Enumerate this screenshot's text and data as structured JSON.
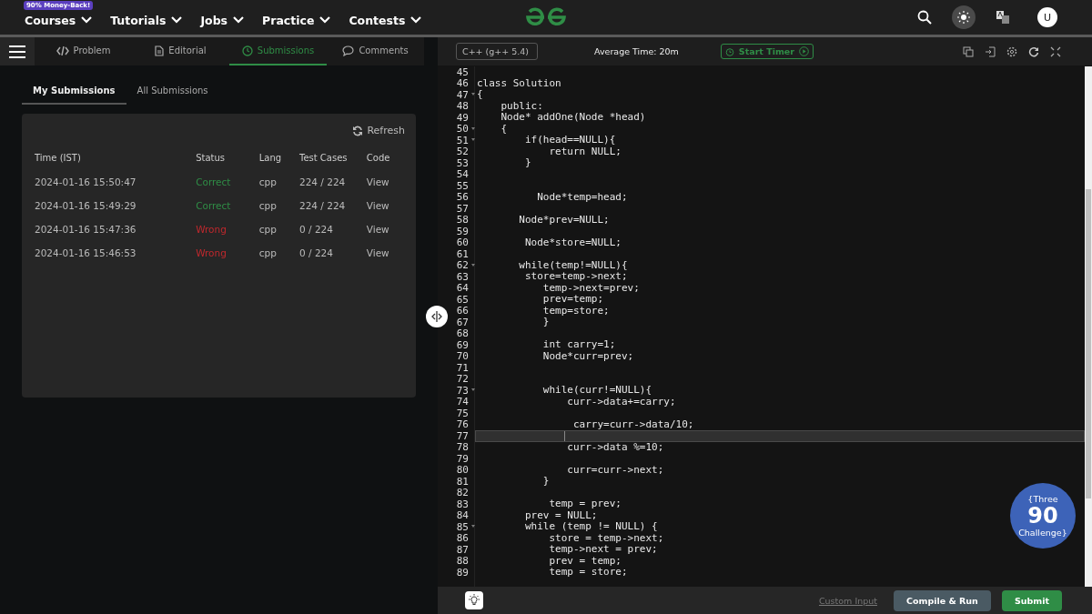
{
  "nav": {
    "badge": "90% Money-Back!",
    "menus": [
      "Courses",
      "Tutorials",
      "Jobs",
      "Practice",
      "Contests"
    ],
    "avatar": "U"
  },
  "tabs": [
    {
      "label": "Problem",
      "selected": false
    },
    {
      "label": "Editorial",
      "selected": false
    },
    {
      "label": "Submissions",
      "selected": true
    },
    {
      "label": "Comments",
      "selected": false
    }
  ],
  "subtabs": [
    {
      "label": "My Submissions",
      "selected": true
    },
    {
      "label": "All Submissions",
      "selected": false
    }
  ],
  "refresh": "Refresh",
  "table": {
    "columns": [
      "Time (IST)",
      "Status",
      "Lang",
      "Test Cases",
      "Code"
    ],
    "rows": [
      {
        "time": "2024-01-16 15:50:47",
        "status": "Correct",
        "kind": "correct",
        "lang": "cpp",
        "tests": "224 / 224",
        "code": "View"
      },
      {
        "time": "2024-01-16 15:49:29",
        "status": "Correct",
        "kind": "correct",
        "lang": "cpp",
        "tests": "224 / 224",
        "code": "View"
      },
      {
        "time": "2024-01-16 15:47:36",
        "status": "Wrong",
        "kind": "wrong",
        "lang": "cpp",
        "tests": "0 / 224",
        "code": "View"
      },
      {
        "time": "2024-01-16 15:46:53",
        "status": "Wrong",
        "kind": "wrong",
        "lang": "cpp",
        "tests": "0 / 224",
        "code": "View"
      }
    ]
  },
  "editor": {
    "language": "C++ (g++ 5.4)",
    "average_time": "Average Time: 20m",
    "timer": "Start Timer",
    "lines": [
      {
        "n": "45",
        "fold": false,
        "current": false
      },
      {
        "n": "46",
        "text": "class Solution",
        "fold": false,
        "current": false
      },
      {
        "n": "47",
        "text": "{",
        "fold": true,
        "current": false
      },
      {
        "n": "48",
        "text": "    public:",
        "fold": false,
        "current": false
      },
      {
        "n": "49",
        "text": "    Node* addOne(Node *head)",
        "fold": false,
        "current": false
      },
      {
        "n": "50",
        "text": "    {",
        "fold": true,
        "current": false
      },
      {
        "n": "51",
        "text": "        if(head==NULL){",
        "fold": true,
        "current": false
      },
      {
        "n": "52",
        "text": "            return NULL;",
        "fold": false,
        "current": false
      },
      {
        "n": "53",
        "text": "        }",
        "fold": false,
        "current": false
      },
      {
        "n": "54",
        "fold": false,
        "current": false
      },
      {
        "n": "55",
        "fold": false,
        "current": false
      },
      {
        "n": "56",
        "text": "          Node*temp=head;",
        "fold": false,
        "current": false
      },
      {
        "n": "57",
        "fold": false,
        "current": false
      },
      {
        "n": "58",
        "text": "       Node*prev=NULL;",
        "fold": false,
        "current": false
      },
      {
        "n": "59",
        "fold": false,
        "current": false
      },
      {
        "n": "60",
        "text": "        Node*store=NULL;",
        "fold": false,
        "current": false
      },
      {
        "n": "61",
        "fold": false,
        "current": false
      },
      {
        "n": "62",
        "text": "       while(temp!=NULL){",
        "fold": true,
        "current": false
      },
      {
        "n": "63",
        "text": "        store=temp->next;",
        "fold": false,
        "current": false
      },
      {
        "n": "64",
        "text": "           temp->next=prev;",
        "fold": false,
        "current": false
      },
      {
        "n": "65",
        "text": "           prev=temp;",
        "fold": false,
        "current": false
      },
      {
        "n": "66",
        "text": "           temp=store;",
        "fold": false,
        "current": false
      },
      {
        "n": "67",
        "text": "           }",
        "fold": false,
        "current": false
      },
      {
        "n": "68",
        "fold": false,
        "current": false
      },
      {
        "n": "69",
        "text": "           int carry=1;",
        "fold": false,
        "current": false
      },
      {
        "n": "70",
        "text": "           Node*curr=prev;",
        "fold": false,
        "current": false
      },
      {
        "n": "71",
        "fold": false,
        "current": false
      },
      {
        "n": "72",
        "fold": false,
        "current": false
      },
      {
        "n": "73",
        "text": "           while(curr!=NULL){",
        "fold": true,
        "current": false
      },
      {
        "n": "74",
        "text": "               curr->data+=carry;",
        "fold": false,
        "current": false
      },
      {
        "n": "75",
        "fold": false,
        "current": false
      },
      {
        "n": "76",
        "text": "                carry=curr->data/10;",
        "fold": false,
        "current": false
      },
      {
        "n": "77",
        "fold": false,
        "current": true
      },
      {
        "n": "78",
        "text": "               curr->data %=10;",
        "fold": false,
        "current": false
      },
      {
        "n": "79",
        "fold": false,
        "current": false
      },
      {
        "n": "80",
        "text": "               curr=curr->next;",
        "fold": false,
        "current": false
      },
      {
        "n": "81",
        "text": "           }",
        "fold": false,
        "current": false
      },
      {
        "n": "82",
        "fold": false,
        "current": false
      },
      {
        "n": "83",
        "text": "            temp = prev;",
        "fold": false,
        "current": false
      },
      {
        "n": "84",
        "text": "        prev = NULL;",
        "fold": false,
        "current": false
      },
      {
        "n": "85",
        "text": "        while (temp != NULL) {",
        "fold": true,
        "current": false
      },
      {
        "n": "86",
        "text": "            store = temp->next;",
        "fold": false,
        "current": false
      },
      {
        "n": "87",
        "text": "            temp->next = prev;",
        "fold": false,
        "current": false
      },
      {
        "n": "88",
        "text": "            prev = temp;",
        "fold": false,
        "current": false
      },
      {
        "n": "89",
        "text": "            temp = store;",
        "fold": false,
        "current": false
      }
    ]
  },
  "footer": {
    "custom_input": "Custom Input",
    "compile": "Compile & Run",
    "submit": "Submit"
  },
  "promo": {
    "top": "{Three",
    "number": "90",
    "bottom": "Challenge}"
  }
}
